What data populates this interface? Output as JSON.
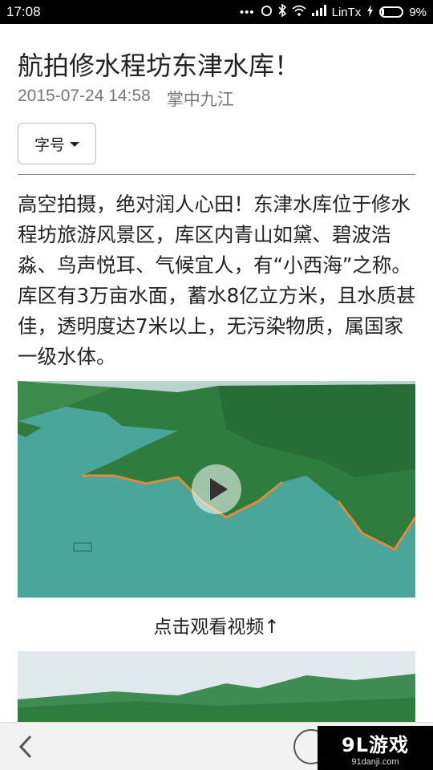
{
  "status_bar": {
    "time": "17:08",
    "dots": "•••",
    "carrier": "LinTx",
    "battery": "9%"
  },
  "article": {
    "title": "航拍修水程坊东津水库！",
    "datetime": "2015-07-24 14:58",
    "source": "掌中九江",
    "font_button": "字号",
    "paragraph": "高空拍摄，绝对润人心田！东津水库位于修水程坊旅游风景区，库区内青山如黛、碧波浩淼、鸟声悦耳、气候宜人，有“小西海”之称。库区有3万亩水面，蓄水8亿立方米，且水质甚佳，透明度达7米以上，无污染物质，属国家一级水体。",
    "video_caption": "点击观看视频↑"
  },
  "watermark": {
    "logo": "9L游戏",
    "url": "91danji.com"
  },
  "colors": {
    "water": "#4aa69a",
    "hills": "#2e7d3f",
    "shore": "#e08a3c"
  }
}
